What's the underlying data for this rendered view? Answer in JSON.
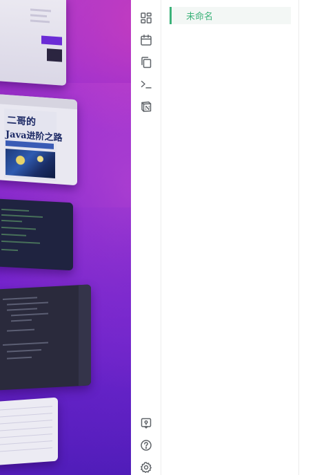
{
  "desktop": {
    "thumbnails": [
      {
        "name": "note-window"
      },
      {
        "name": "ebook-viewer",
        "book_title_line1": "二哥的",
        "book_title_line2": "Java进阶之路"
      },
      {
        "name": "terminal-window"
      },
      {
        "name": "code-editor-window"
      },
      {
        "name": "document-window"
      }
    ]
  },
  "rail": {
    "items": [
      {
        "icon": "dashboard-icon"
      },
      {
        "icon": "calendar-icon"
      },
      {
        "icon": "copy-icon"
      },
      {
        "icon": "terminal-icon"
      },
      {
        "icon": "notion-icon",
        "glyph": "N"
      }
    ],
    "bottom": [
      {
        "icon": "map-pin-icon"
      },
      {
        "icon": "help-icon"
      },
      {
        "icon": "settings-icon"
      }
    ]
  },
  "notes": {
    "items": [
      {
        "label": "未命名",
        "active": true
      }
    ]
  },
  "colors": {
    "accent": "#3bb279",
    "active_bg": "#f3f7f5",
    "icon": "#5f6368"
  }
}
